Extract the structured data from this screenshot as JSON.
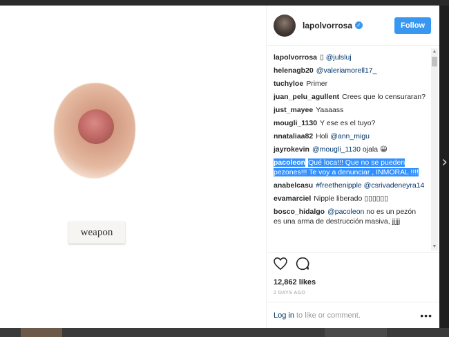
{
  "post": {
    "image_caption": "weapon",
    "author": "lapolvorrosa",
    "follow_label": "Follow"
  },
  "comments": [
    {
      "user": "lapolvorrosa",
      "pre": "",
      "mention": "@julsluj",
      "post": "",
      "glyph": "▯ "
    },
    {
      "user": "helenagb20",
      "pre": "",
      "mention": "@valeriamorell17_",
      "post": ""
    },
    {
      "user": "tuchyloe",
      "pre": "Primer",
      "mention": "",
      "post": ""
    },
    {
      "user": "juan_pelu_agullent",
      "pre": "Crees que lo censuraran?",
      "mention": "",
      "post": ""
    },
    {
      "user": "just_mayee",
      "pre": "Yaaaass",
      "mention": "",
      "post": ""
    },
    {
      "user": "mougli_1130",
      "pre": "Y ese es el tuyo?",
      "mention": "",
      "post": ""
    },
    {
      "user": "nnataliaa82",
      "pre": "Holi",
      "mention": "@ann_migu",
      "post": ""
    },
    {
      "user": "jayrokevin",
      "pre": "",
      "mention": "@mougli_1130",
      "post": "ojala 😀"
    },
    {
      "user": "pacoleon",
      "pre": "Qué loca!!! Que no se pueden pezones!!! Te voy a denunciar , INMORAL !!!!",
      "mention": "",
      "post": "",
      "selected": true
    },
    {
      "user": "anabelcasu",
      "pre": "",
      "mention": "#freethenipple @csrivadeneyra14",
      "post": ""
    },
    {
      "user": "evamarciel",
      "pre": "Nipple liberado ▯▯▯▯▯▯",
      "mention": "",
      "post": ""
    },
    {
      "user": "bosco_hidalgo",
      "pre": "",
      "mention": "@pacoleon",
      "post": "no es un pezón es una arma de destrucción masiva, jjjjj"
    }
  ],
  "stats": {
    "likes": "12,862 likes",
    "time": "2 DAYS AGO"
  },
  "footer": {
    "login": "Log in",
    "rest": "to like or comment."
  },
  "icons": {
    "like": "heart-icon",
    "comment": "comment-icon",
    "more": "more-icon",
    "verified": "verified-icon"
  },
  "colors": {
    "accent": "#3897f0",
    "link": "#003569",
    "selection": "#3390ff"
  }
}
